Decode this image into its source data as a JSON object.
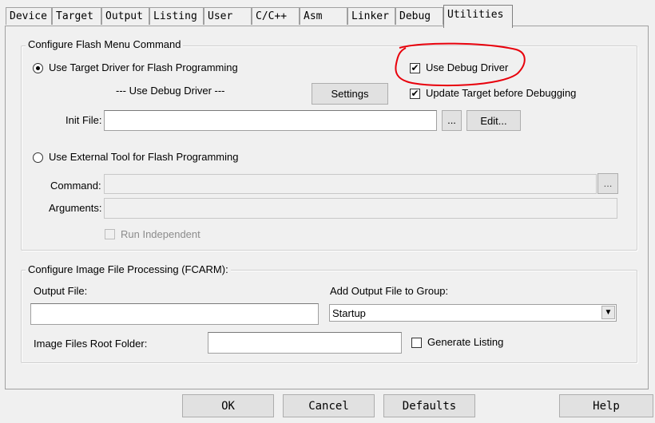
{
  "tabs": [
    {
      "label": "Device"
    },
    {
      "label": "Target"
    },
    {
      "label": "Output"
    },
    {
      "label": "Listing"
    },
    {
      "label": "User"
    },
    {
      "label": "C/C++"
    },
    {
      "label": "Asm"
    },
    {
      "label": "Linker"
    },
    {
      "label": "Debug"
    },
    {
      "label": "Utilities",
      "active": true
    }
  ],
  "flash_group": {
    "title": "Configure Flash Menu Command",
    "use_target_driver": {
      "label": "Use Target Driver for Flash Programming",
      "selected": true
    },
    "driver_selection": "--- Use Debug Driver ---",
    "settings_label": "Settings",
    "use_debug_driver": {
      "label": "Use Debug Driver",
      "checked": true,
      "check_glyph": "✔"
    },
    "update_target": {
      "label": "Update Target before Debugging",
      "checked": true,
      "check_glyph": "✔"
    },
    "init_file": {
      "label": "Init File:",
      "value": ""
    },
    "browse_label": "...",
    "edit_label": "Edit...",
    "use_external_tool": {
      "label": "Use External Tool for Flash Programming",
      "selected": false
    },
    "command": {
      "label": "Command:",
      "value": ""
    },
    "arguments": {
      "label": "Arguments:",
      "value": ""
    },
    "run_independent": {
      "label": "Run Independent",
      "checked": false,
      "enabled": false
    }
  },
  "image_group": {
    "title": "Configure Image File Processing (FCARM):",
    "output_file": {
      "label": "Output File:",
      "value": ""
    },
    "add_output_group": {
      "label": "Add Output File  to Group:",
      "selected": "Startup"
    },
    "root_folder": {
      "label": "Image Files Root Folder:",
      "value": ""
    },
    "generate_listing": {
      "label": "Generate Listing",
      "checked": false
    }
  },
  "buttons": {
    "ok": "OK",
    "cancel": "Cancel",
    "defaults": "Defaults",
    "help": "Help"
  },
  "colors": {
    "highlight_annotation": "#e8000b"
  }
}
